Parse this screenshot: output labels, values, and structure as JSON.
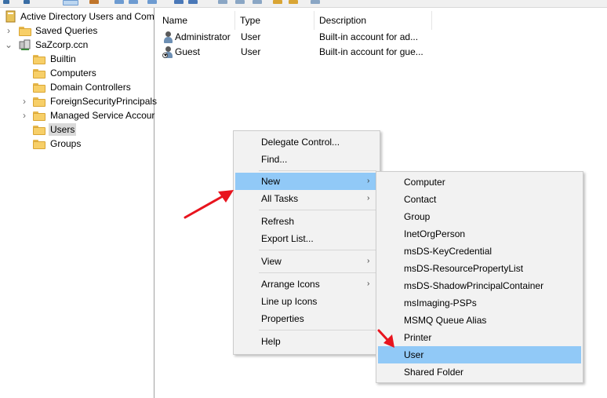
{
  "tree": {
    "root_label": "Active Directory Users and Com",
    "items": [
      {
        "label": "Saved Queries",
        "expander": "›"
      },
      {
        "label": "SaZcorp.ccn",
        "expander": "⌄"
      },
      {
        "label": "Builtin",
        "expander": ""
      },
      {
        "label": "Computers",
        "expander": ""
      },
      {
        "label": "Domain Controllers",
        "expander": ""
      },
      {
        "label": "ForeignSecurityPrincipals",
        "expander": "›"
      },
      {
        "label": "Managed Service Accour",
        "expander": "›"
      },
      {
        "label": "Users",
        "expander": "",
        "selected": true
      },
      {
        "label": "Groups",
        "expander": ""
      }
    ]
  },
  "list": {
    "columns": [
      "Name",
      "Type",
      "Description"
    ],
    "rows": [
      {
        "name": "Administrator",
        "type": "User",
        "description": "Built-in account for ad..."
      },
      {
        "name": "Guest",
        "type": "User",
        "description": "Built-in account for gue..."
      }
    ]
  },
  "context_menu": {
    "items": [
      "Delegate Control...",
      "Find...",
      "New",
      "All Tasks",
      "Refresh",
      "Export List...",
      "View",
      "Arrange Icons",
      "Line up Icons",
      "Properties",
      "Help"
    ],
    "highlighted": "New",
    "arrow_glyph": "›"
  },
  "new_submenu": {
    "items": [
      "Computer",
      "Contact",
      "Group",
      "InetOrgPerson",
      "msDS-KeyCredential",
      "msDS-ResourcePropertyList",
      "msDS-ShadowPrincipalContainer",
      "msImaging-PSPs",
      "MSMQ Queue Alias",
      "Printer",
      "User",
      "Shared Folder"
    ],
    "highlighted": "User"
  },
  "colors": {
    "highlight": "#91c9f7",
    "annotation_arrow": "#e8141e",
    "menu_bg": "#f2f2f2"
  }
}
